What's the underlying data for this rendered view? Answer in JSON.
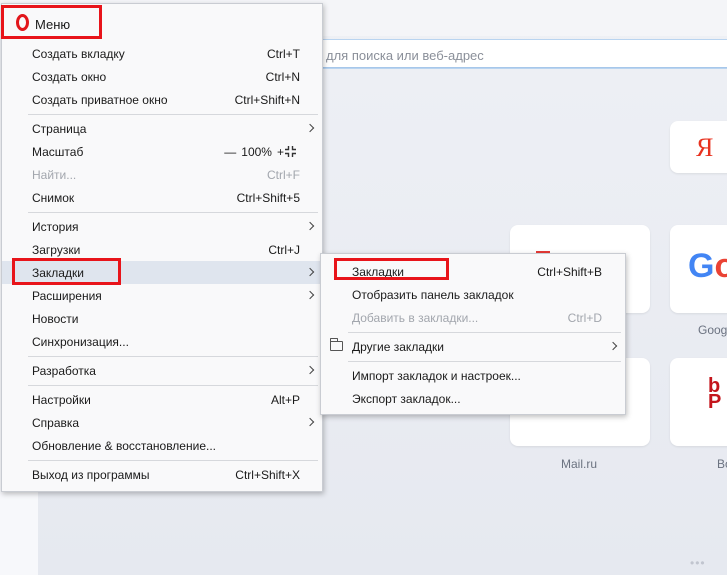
{
  "address_bar": {
    "placeholder": "для поиска или веб-адрес"
  },
  "speed_dial": {
    "yandex_glyph": "Я",
    "google_glyph_g": "G",
    "google_glyph_o": "o",
    "google_label": "Goog",
    "mail_label": "Mail.ru",
    "brand_glyph": "b\nP",
    "brand_label": "Bo"
  },
  "menu": {
    "title": "Меню",
    "items": {
      "new_tab": {
        "label": "Создать вкладку",
        "shortcut": "Ctrl+T"
      },
      "new_window": {
        "label": "Создать окно",
        "shortcut": "Ctrl+N"
      },
      "new_private": {
        "label": "Создать приватное окно",
        "shortcut": "Ctrl+Shift+N"
      },
      "page": {
        "label": "Страница"
      },
      "zoom": {
        "label": "Масштаб",
        "minus": "—",
        "value": "100%",
        "plus": "+"
      },
      "find": {
        "label": "Найти...",
        "shortcut": "Ctrl+F"
      },
      "snapshot": {
        "label": "Снимок",
        "shortcut": "Ctrl+Shift+5"
      },
      "history": {
        "label": "История"
      },
      "downloads": {
        "label": "Загрузки",
        "shortcut": "Ctrl+J"
      },
      "bookmarks": {
        "label": "Закладки"
      },
      "extensions": {
        "label": "Расширения"
      },
      "news": {
        "label": "Новости"
      },
      "sync": {
        "label": "Синхронизация..."
      },
      "developer": {
        "label": "Разработка"
      },
      "settings": {
        "label": "Настройки",
        "shortcut": "Alt+P"
      },
      "help": {
        "label": "Справка"
      },
      "update": {
        "label": "Обновление & восстановление..."
      },
      "exit": {
        "label": "Выход из программы",
        "shortcut": "Ctrl+Shift+X"
      }
    }
  },
  "submenu": {
    "items": {
      "bookmarks": {
        "label": "Закладки",
        "shortcut": "Ctrl+Shift+B"
      },
      "show_bar": {
        "label": "Отобразить панель закладок"
      },
      "add": {
        "label": "Добавить в закладки...",
        "shortcut": "Ctrl+D"
      },
      "other": {
        "label": "Другие закладки"
      },
      "import": {
        "label": "Импорт закладок и настроек..."
      },
      "export": {
        "label": "Экспорт закладок..."
      }
    }
  },
  "colors": {
    "highlight": "#e8141a",
    "opera_red": "#e2161b",
    "active_row": "#dfe5ee"
  },
  "icons": {
    "logo": "opera-logo-icon",
    "submenu_arrow": "chevron-right-icon",
    "fullscreen": "fullscreen-icon",
    "folder": "folder-icon"
  }
}
